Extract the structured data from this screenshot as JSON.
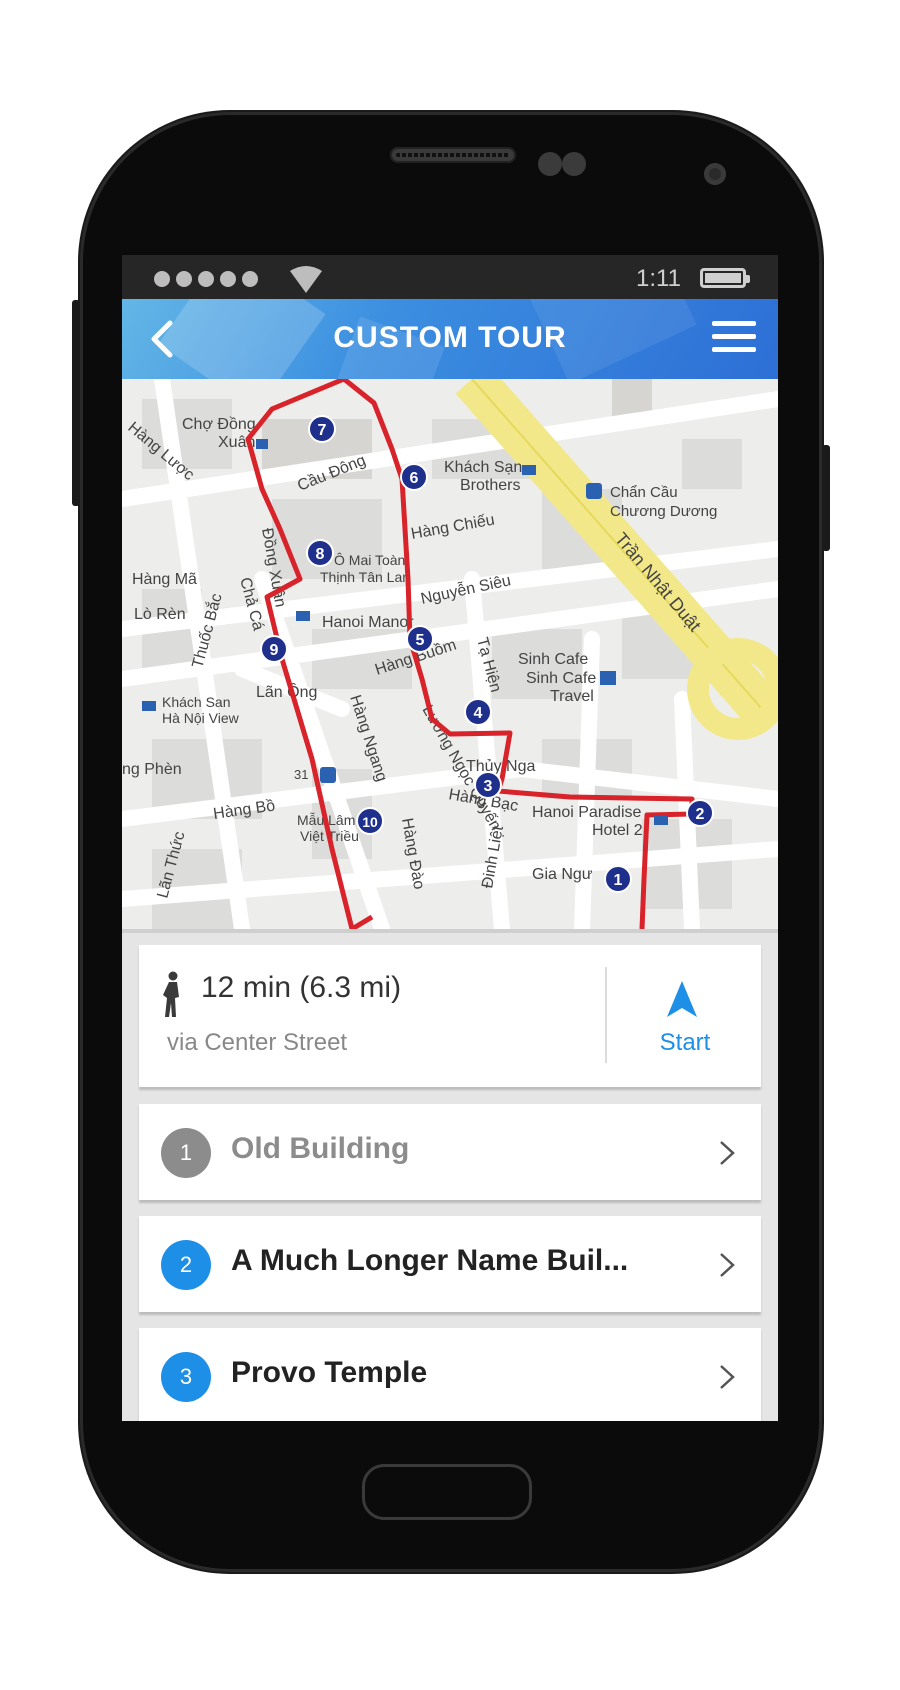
{
  "status_bar": {
    "time": "1:11",
    "signal_icon": "signal-dots-icon",
    "wifi_icon": "wifi-icon",
    "battery_icon": "battery-icon"
  },
  "header": {
    "title": "CUSTOM TOUR",
    "back_icon": "chevron-left-icon",
    "menu_icon": "hamburger-menu-icon",
    "gradient": [
      "#63b6e6",
      "#2d6fd6"
    ]
  },
  "map": {
    "streets": [
      "Hàng Lược",
      "Chợ Đồng Xuân",
      "Cầu Đông",
      "Khách Sạn Brothers",
      "Chẩn Cầu Chương Dương",
      "Trần Nhật Duật",
      "Hàng Chiếu",
      "Đồng Xuân",
      "Hàng Mã",
      "Ô Mai Toàn Thịnh Tân Lan",
      "Nguyễn Siêu",
      "Lò Rèn",
      "Thuốc Bắc",
      "Chả Cá",
      "Hanoi Manor",
      "Hàng Buồm",
      "Tạ Hiện",
      "Sinh Cafe Sinh Cafe Travel",
      "Lãn Ông",
      "Hàng Ngang",
      "Lương Ngọc Quyến",
      "Khách Sạn Hà Nội View",
      "Hàng Phèn",
      "Thủy Nga",
      "Hàng Bạc",
      "Hàng Bồ",
      "Mẫu Lâm Việt Triều",
      "Hanoi Paradise Hotel 2",
      "Hàng Đào",
      "Đinh Liệt",
      "Gia Ngư",
      "Lãn Thức",
      "31"
    ],
    "route_color": "#d8232a",
    "marker_color": "#1f2f8c",
    "markers": [
      "1",
      "2",
      "3",
      "4",
      "5",
      "6",
      "7",
      "8",
      "9",
      "10"
    ]
  },
  "route_summary": {
    "walk_icon": "walking-person-icon",
    "duration": "12 min (6.3 mi)",
    "via": "via Center Street",
    "start_label": "Start",
    "start_icon": "navigation-arrow-icon",
    "accent": "#1e8fe6"
  },
  "stops": [
    {
      "number": "1",
      "name": "Old Building",
      "badge_color": "#8c8c8c",
      "text_color": "#8c8c8c",
      "chevron_icon": "chevron-right-icon"
    },
    {
      "number": "2",
      "name": "A Much Longer Name Buil...",
      "badge_color": "#1e8fe6",
      "text_color": "#222222",
      "chevron_icon": "chevron-right-icon"
    },
    {
      "number": "3",
      "name": "Provo Temple",
      "badge_color": "#1e8fe6",
      "text_color": "#222222",
      "chevron_icon": "chevron-right-icon"
    }
  ]
}
